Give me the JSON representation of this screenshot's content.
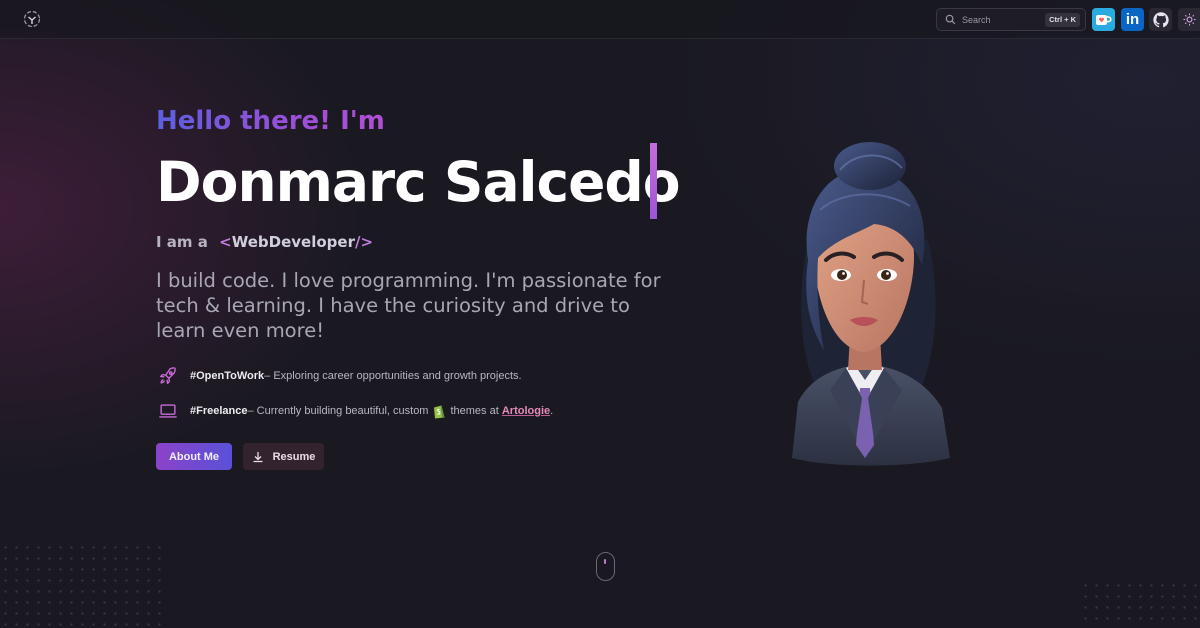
{
  "header": {
    "search": {
      "placeholder": "Search",
      "shortcut": "Ctrl + K"
    },
    "social": [
      {
        "name": "ko-fi",
        "icon": "kofi-cup-icon",
        "color": "#29abe0"
      },
      {
        "name": "linkedin",
        "label": "in",
        "icon": "linkedin-icon",
        "color": "#0a66c2"
      },
      {
        "name": "github",
        "icon": "github-icon"
      }
    ],
    "theme_icon": "sun-icon"
  },
  "hero": {
    "greeting": "Hello there! I'm",
    "name": "Donmarc Salcedo",
    "role_prefix": "I am a",
    "role_open": "<",
    "role": "WebDeveloper",
    "role_close": "/>",
    "bio": "I build code. I love programming. I'm passionate for tech & learning. I have the curiosity and drive to learn even more!",
    "items": [
      {
        "icon": "rocket-icon",
        "hashtag": "#OpenToWork",
        "text": " – Exploring career opportunities and growth projects."
      },
      {
        "icon": "laptop-icon",
        "hashtag": "#Freelance",
        "text_before": " – Currently building beautiful, custom",
        "text_after": "themes at",
        "link": "Artologie",
        "end": "."
      }
    ],
    "buttons": {
      "about": "About Me",
      "resume": "Resume"
    }
  },
  "colors": {
    "accent_purple": "#9b4fd8",
    "accent_blue": "#5a51d8",
    "link_pink": "#e58bb8",
    "background": "#1a1921"
  }
}
